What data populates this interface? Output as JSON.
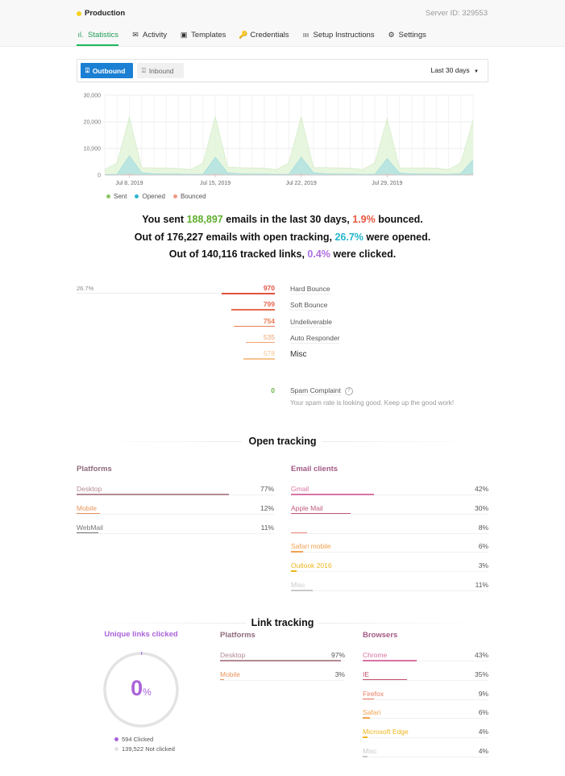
{
  "header": {
    "server_name": "Production",
    "status_color": "#f5d21f",
    "server_id": "Server ID: 329553"
  },
  "nav": [
    {
      "label": "Statistics",
      "icon": "bar-chart-icon",
      "glyph": "ıl.",
      "active": true
    },
    {
      "label": "Activity",
      "icon": "envelope-icon",
      "glyph": "✉",
      "active": false
    },
    {
      "label": "Templates",
      "icon": "template-icon",
      "glyph": "▣",
      "active": false
    },
    {
      "label": "Credentials",
      "icon": "key-icon",
      "glyph": "🔑",
      "active": false
    },
    {
      "label": "Setup Instructions",
      "icon": "setup-icon",
      "glyph": "ııı",
      "active": false
    },
    {
      "label": "Settings",
      "icon": "gear-icon",
      "glyph": "⚙",
      "active": false
    }
  ],
  "toolbar": {
    "outbound_label": "Outbound",
    "inbound_label": "Inbound",
    "range_label": "Last 30 days",
    "accent": "#1b7fd3"
  },
  "chart_data": {
    "type": "area",
    "title": "",
    "xlabel": "",
    "ylabel": "",
    "ylim": [
      0,
      30000
    ],
    "yticks": [
      0,
      10000,
      20000,
      30000
    ],
    "ytick_labels": [
      "0",
      "10,000",
      "20,000",
      "30,000"
    ],
    "xtick_labels": [
      "Jul 8, 2019",
      "Jul 15, 2019",
      "Jul 22, 2019",
      "Jul 29, 2019"
    ],
    "xtick_index": [
      2,
      9,
      16,
      23
    ],
    "grid": true,
    "legend": "bottom-left",
    "x": [
      "Jul 6",
      "Jul 7",
      "Jul 8",
      "Jul 9",
      "Jul 10",
      "Jul 11",
      "Jul 12",
      "Jul 13",
      "Jul 14",
      "Jul 15",
      "Jul 16",
      "Jul 17",
      "Jul 18",
      "Jul 19",
      "Jul 20",
      "Jul 21",
      "Jul 22",
      "Jul 23",
      "Jul 24",
      "Jul 25",
      "Jul 26",
      "Jul 27",
      "Jul 28",
      "Jul 29",
      "Jul 30",
      "Jul 31",
      "Aug 1",
      "Aug 2",
      "Aug 3",
      "Aug 4",
      "Aug 5"
    ],
    "series": [
      {
        "name": "Sent",
        "color": "#8cc665",
        "fill": "#e3f5d9",
        "values": [
          2100,
          4500,
          21800,
          2800,
          2700,
          2700,
          2500,
          2100,
          4500,
          22000,
          3000,
          2800,
          2700,
          2600,
          2100,
          4600,
          21900,
          2800,
          2800,
          2700,
          2600,
          2100,
          4600,
          21300,
          2700,
          2700,
          2700,
          2600,
          2100,
          4600,
          20800
        ]
      },
      {
        "name": "Opened",
        "color": "#2fb5cf",
        "fill": "#b3e2e2",
        "values": [
          200,
          300,
          7200,
          900,
          500,
          400,
          400,
          300,
          300,
          6700,
          900,
          500,
          400,
          400,
          300,
          300,
          6700,
          900,
          500,
          400,
          400,
          300,
          300,
          6200,
          800,
          500,
          400,
          400,
          300,
          600,
          5700
        ]
      },
      {
        "name": "Bounced",
        "color": "#ef9a85",
        "fill": "#f6c3b5",
        "values": [
          50,
          80,
          350,
          90,
          60,
          60,
          50,
          50,
          80,
          330,
          90,
          60,
          60,
          50,
          50,
          80,
          300,
          90,
          60,
          60,
          50,
          50,
          80,
          300,
          80,
          60,
          60,
          50,
          50,
          80,
          280
        ]
      }
    ]
  },
  "summary": {
    "line1": {
      "a": "You sent ",
      "sent": "188,897",
      "b": " emails in the last 30 days, ",
      "bounce": "1.9%",
      "c": " bounced."
    },
    "line2": {
      "a": "Out of 176,227 emails with open tracking, ",
      "opened": "26.7%",
      "b": " were opened."
    },
    "line3": {
      "a": "Out of 140,116 tracked links, ",
      "clicked": "0.4%",
      "b": " were clicked."
    },
    "colors": {
      "sent": "#5fae2e",
      "bounce": "#e8553e",
      "opened": "#22b6cc",
      "clicked": "#b06ee0"
    }
  },
  "bounces": {
    "left_label": "26.7%",
    "rows": [
      {
        "count": 970,
        "label": "Hard Bounce",
        "color": "#e0533f"
      },
      {
        "count": 799,
        "label": "Soft Bounce",
        "color": "#e86a4f"
      },
      {
        "count": 754,
        "label": "Undeliverable",
        "color": "#ec7d58"
      },
      {
        "count": 535,
        "label": "Auto Responder",
        "color": "#f2a26c"
      },
      {
        "count": 578,
        "label": "Misc",
        "color": "#f7c590"
      }
    ],
    "spam": {
      "count": "0",
      "label": "Spam Complaint",
      "help": "?",
      "message": "Your spam rate is looking good. Keep up the good work!"
    }
  },
  "open_tracking": {
    "title": "Open tracking",
    "platforms": {
      "title": "Platforms",
      "title_color": "#8e6a7c",
      "rows": [
        {
          "label": "Desktop",
          "percent": 77,
          "color": "#b38a92"
        },
        {
          "label": "Mobile",
          "percent": 12,
          "color": "#e9955c"
        },
        {
          "label": "WebMail",
          "percent": 11,
          "color": "#777777"
        }
      ]
    },
    "email_clients": {
      "title": "Email clients",
      "title_color": "#a35a85",
      "rows": [
        {
          "label": "Gmail",
          "percent": 42,
          "color": "#d873a3"
        },
        {
          "label": "Apple Mail",
          "percent": 30,
          "color": "#c25a80"
        },
        {
          "label": "",
          "percent": 8,
          "color": "#ec8a7a"
        },
        {
          "label": "Safari mobile",
          "percent": 6,
          "color": "#f3a14f"
        },
        {
          "label": "Outlook 2016",
          "percent": 3,
          "color": "#eeb51c"
        },
        {
          "label": "Misc",
          "percent": 11,
          "color": "#c9c9c9"
        }
      ]
    }
  },
  "link_tracking": {
    "title": "Link tracking",
    "unique": {
      "title": "Unique links clicked",
      "value": "0",
      "unit": "%",
      "fraction": 0.004,
      "color": "#a963d9",
      "track_color": "#e3e3e3",
      "clicked_label": "594 Clicked",
      "not_clicked_label": "139,522 Not clicked"
    },
    "platforms": {
      "title": "Platforms",
      "title_color": "#8e6a7c",
      "rows": [
        {
          "label": "Desktop",
          "percent": 97,
          "color": "#b38a92"
        },
        {
          "label": "Mobile",
          "percent": 3,
          "color": "#e9955c"
        }
      ]
    },
    "browsers": {
      "title": "Browsers",
      "title_color": "#a35a85",
      "rows": [
        {
          "label": "Chrome",
          "percent": 43,
          "color": "#d873a3"
        },
        {
          "label": "IE",
          "percent": 35,
          "color": "#c44f6c"
        },
        {
          "label": "Firefox",
          "percent": 9,
          "color": "#e8795d"
        },
        {
          "label": "Safari",
          "percent": 6,
          "color": "#f3a14f"
        },
        {
          "label": "Microsoft Edge",
          "percent": 4,
          "color": "#eeb51c"
        },
        {
          "label": "Misc",
          "percent": 4,
          "color": "#c9c9c9"
        }
      ]
    }
  }
}
